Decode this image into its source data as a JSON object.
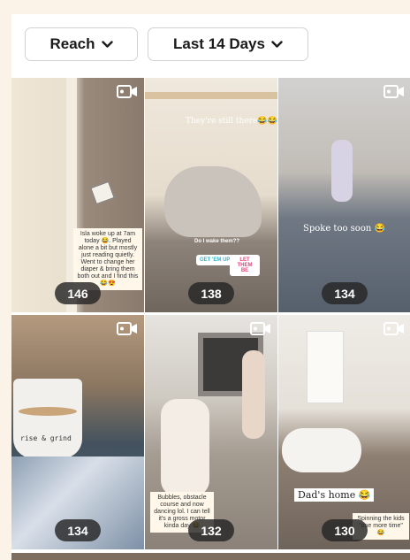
{
  "filters": {
    "metric": "Reach",
    "range": "Last 14 Days"
  },
  "tiles": [
    {
      "count": "146",
      "caption": "Isla woke up at 7am today 😂. Played alone a bit but mostly just reading quietly. Went to change her diaper & bring them both out and I find this 😂😍"
    },
    {
      "count": "138",
      "overlay": "They're still there😂😂",
      "question": "Do I wake them??",
      "option_a": "GET 'EM UP",
      "option_b": "LET THEM BE"
    },
    {
      "count": "134",
      "overlay": "Spoke too soon 😂"
    },
    {
      "count": "134",
      "mug_text": "rise & grind"
    },
    {
      "count": "132",
      "caption": "Bubbles, obstacle course and now dancing lol. I can tell it's a gross motor kinda day 😂"
    },
    {
      "count": "130",
      "overlay": "Dad's home 😂",
      "caption": "Spinning the kids \"one more time\" 😂"
    }
  ],
  "icons": {
    "video": "video-camera-icon",
    "chevron": "chevron-down-icon"
  }
}
